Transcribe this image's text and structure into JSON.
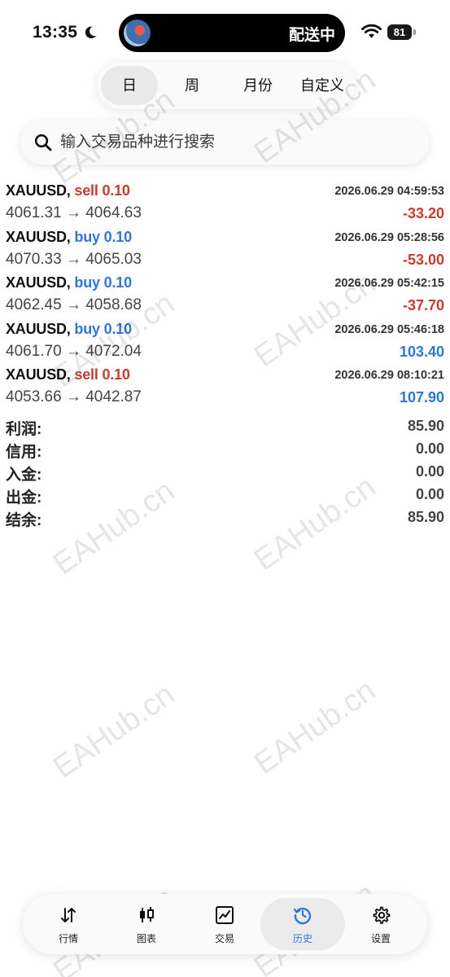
{
  "status_bar": {
    "time": "13:35",
    "island_text": "配送中",
    "battery": "81",
    "icons": [
      "moon-icon",
      "wifi-icon",
      "battery-icon"
    ]
  },
  "period_tabs": {
    "items": [
      {
        "label": "日",
        "active": true
      },
      {
        "label": "周",
        "active": false
      },
      {
        "label": "月份",
        "active": false
      },
      {
        "label": "自定义",
        "active": false
      }
    ]
  },
  "search": {
    "placeholder": "输入交易品种进行搜索"
  },
  "trades": [
    {
      "symbol": "XAUUSD,",
      "side": "sell",
      "volume": "0.10",
      "time": "2026.06.29 04:59:53",
      "prices": "4061.31 → 4064.63",
      "profit": "-33.20"
    },
    {
      "symbol": "XAUUSD,",
      "side": "buy",
      "volume": "0.10",
      "time": "2026.06.29 05:28:56",
      "prices": "4070.33 → 4065.03",
      "profit": "-53.00"
    },
    {
      "symbol": "XAUUSD,",
      "side": "buy",
      "volume": "0.10",
      "time": "2026.06.29 05:42:15",
      "prices": "4062.45 → 4058.68",
      "profit": "-37.70"
    },
    {
      "symbol": "XAUUSD,",
      "side": "buy",
      "volume": "0.10",
      "time": "2026.06.29 05:46:18",
      "prices": "4061.70 → 4072.04",
      "profit": "103.40"
    },
    {
      "symbol": "XAUUSD,",
      "side": "sell",
      "volume": "0.10",
      "time": "2026.06.29 08:10:21",
      "prices": "4053.66 → 4042.87",
      "profit": "107.90"
    }
  ],
  "summary": [
    {
      "label": "利润:",
      "value": "85.90"
    },
    {
      "label": "信用:",
      "value": "0.00"
    },
    {
      "label": "入金:",
      "value": "0.00"
    },
    {
      "label": "出金:",
      "value": "0.00"
    },
    {
      "label": "结余:",
      "value": "85.90"
    }
  ],
  "watermark": "EAHub.cn",
  "bottom_nav": {
    "items": [
      {
        "label": "行情",
        "icon": "quotes-arrows-icon",
        "active": false
      },
      {
        "label": "图表",
        "icon": "candlestick-icon",
        "active": false
      },
      {
        "label": "交易",
        "icon": "trade-chart-icon",
        "active": false
      },
      {
        "label": "历史",
        "icon": "history-clock-icon",
        "active": true
      },
      {
        "label": "设置",
        "icon": "gear-icon",
        "active": false
      }
    ]
  },
  "colors": {
    "sell": "#cc3a2e",
    "buy": "#2f76d6",
    "negative": "#cc3a2e",
    "positive": "#2f76d6",
    "active_nav": "#2f76d6"
  }
}
